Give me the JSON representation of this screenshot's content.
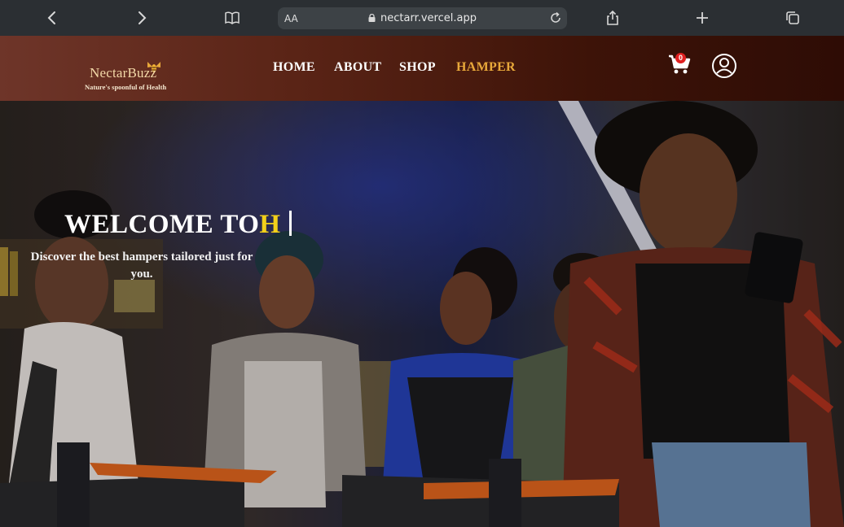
{
  "browser": {
    "text_size_label": "AA",
    "url": "nectarr.vercel.app"
  },
  "header": {
    "logo_name": "NectarBuzz",
    "logo_tagline": "Nature's spoonful of Health",
    "nav": [
      {
        "label": "HOME",
        "active": false
      },
      {
        "label": "ABOUT",
        "active": false
      },
      {
        "label": "SHOP",
        "active": false
      },
      {
        "label": "HAMPER",
        "active": true
      }
    ],
    "cart_count": "0",
    "accent_color": "#e8a83a"
  },
  "hero": {
    "welcome_text": "WELCOME TO",
    "typed_text": "H",
    "subtitle": "Discover the best hampers tailored just for you.",
    "typed_color": "#f2d01a"
  },
  "icons": [
    "back-icon",
    "forward-icon",
    "reader-icon",
    "lock-icon",
    "reload-icon",
    "share-icon",
    "new-tab-icon",
    "tabs-icon",
    "cart-icon",
    "user-icon",
    "bee-icon"
  ]
}
